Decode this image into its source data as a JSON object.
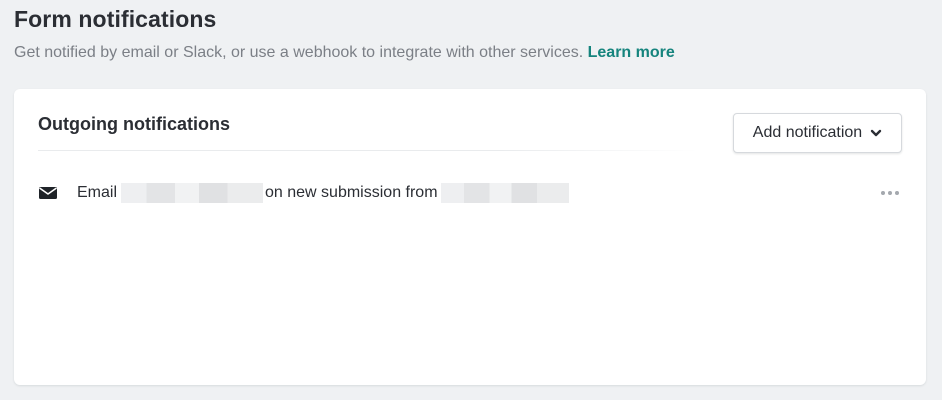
{
  "header": {
    "title": "Form notifications",
    "subtitle": "Get notified by email or Slack, or use a webhook to integrate with other services.",
    "learn_more": "Learn more"
  },
  "card": {
    "heading": "Outgoing notifications",
    "add_button_label": "Add notification",
    "add_button_icon": "chevron-down-icon",
    "notifications": [
      {
        "icon": "mail-icon",
        "type_label": "Email",
        "middle_text": "on new submission from",
        "recipient_redacted": true,
        "form_redacted": true,
        "menu_icon": "more-horizontal-icon"
      }
    ]
  },
  "colors": {
    "background": "#eff1f3",
    "link": "#15847d",
    "text": "#2b2e34",
    "muted": "#7b7f86"
  }
}
